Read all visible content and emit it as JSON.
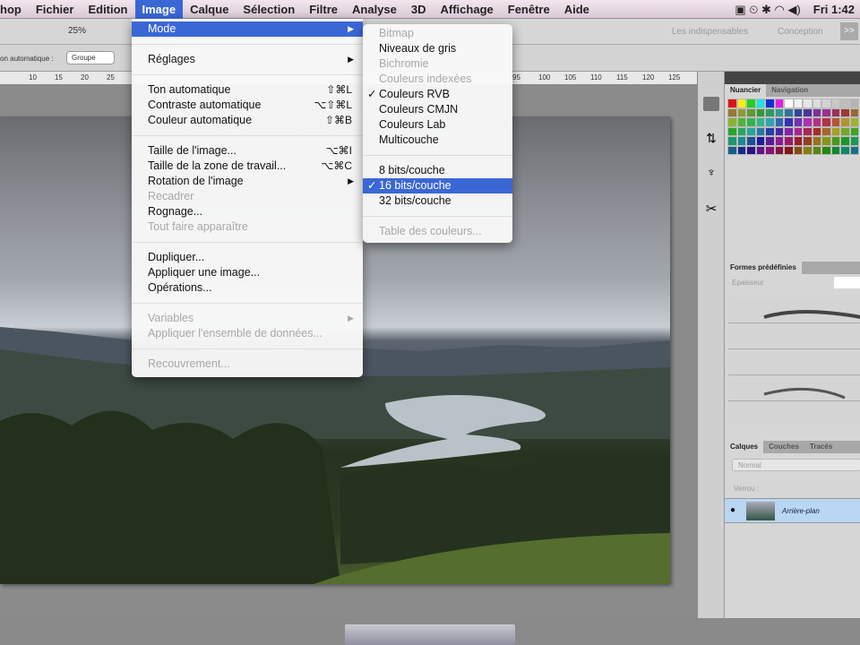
{
  "menubar": {
    "app": "hop",
    "items": [
      "Fichier",
      "Edition",
      "Image",
      "Calque",
      "Sélection",
      "Filtre",
      "Analyse",
      "3D",
      "Affichage",
      "Fenêtre",
      "Aide"
    ],
    "clock": "Fri 1:42"
  },
  "appbar": {
    "zoom": "25%",
    "workspace1": "Les indispensables",
    "workspace2": "Conception",
    "more": ">>"
  },
  "optbar": {
    "label": "on automatique :",
    "select": "Groupe"
  },
  "ruler": {
    "left": [
      "10",
      "15",
      "20",
      "25"
    ],
    "right": [
      "95",
      "100",
      "105",
      "110",
      "115",
      "120",
      "125"
    ]
  },
  "image_menu": {
    "items": [
      {
        "label": "Mode",
        "arrow": true,
        "highlight": true
      },
      {
        "sep": true
      },
      {
        "label": "Réglages",
        "arrow": true
      },
      {
        "sep": true
      },
      {
        "label": "Ton automatique",
        "shortcut": "⇧⌘L"
      },
      {
        "label": "Contraste automatique",
        "shortcut": "⌥⇧⌘L"
      },
      {
        "label": "Couleur automatique",
        "shortcut": "⇧⌘B"
      },
      {
        "sep": true
      },
      {
        "label": "Taille de l'image...",
        "shortcut": "⌥⌘I"
      },
      {
        "label": "Taille de la zone de travail...",
        "shortcut": "⌥⌘C"
      },
      {
        "label": "Rotation de l'image",
        "arrow": true
      },
      {
        "label": "Recadrer",
        "disabled": true
      },
      {
        "label": "Rognage..."
      },
      {
        "label": "Tout faire apparaître",
        "disabled": true
      },
      {
        "sep": true
      },
      {
        "label": "Dupliquer..."
      },
      {
        "label": "Appliquer une image..."
      },
      {
        "label": "Opérations..."
      },
      {
        "sep": true
      },
      {
        "label": "Variables",
        "arrow": true,
        "disabled": true
      },
      {
        "label": "Appliquer l'ensemble de données...",
        "disabled": true
      },
      {
        "sep": true
      },
      {
        "label": "Recouvrement...",
        "disabled": true
      }
    ]
  },
  "mode_menu": {
    "items": [
      {
        "label": "Bitmap",
        "disabled": true
      },
      {
        "label": "Niveaux de gris"
      },
      {
        "label": "Bichromie",
        "disabled": true
      },
      {
        "label": "Couleurs indexées",
        "disabled": true
      },
      {
        "label": "Couleurs RVB",
        "checked": true
      },
      {
        "label": "Couleurs CMJN"
      },
      {
        "label": "Couleurs Lab"
      },
      {
        "label": "Multicouche"
      },
      {
        "sep": true
      },
      {
        "label": "8 bits/couche"
      },
      {
        "label": "16 bits/couche",
        "checked": true,
        "highlight": true
      },
      {
        "label": "32 bits/couche"
      },
      {
        "sep": true
      },
      {
        "label": "Table des couleurs...",
        "disabled": true
      }
    ]
  },
  "panels": {
    "swatches_tabs": [
      "Nuancier",
      "Navigation"
    ],
    "brush_tab": "Formes prédéfinies",
    "brush_label": "Epaisseur",
    "layers_tabs": [
      "Calques",
      "Couches",
      "Tracés"
    ],
    "blend_mode": "Normal",
    "lock_label": "Verrou :",
    "layer_name": "Arrière-plan"
  },
  "swatch_colors": [
    "#e0101a",
    "#f5f000",
    "#20d020",
    "#20e0e8",
    "#1030d0",
    "#e020e0",
    "#ffffff",
    "#f0f0f0",
    "#e6e6e6",
    "#dcdcdc",
    "#d2d2d2",
    "#c8c8c8",
    "#bebebe",
    "#b4b4b4"
  ]
}
